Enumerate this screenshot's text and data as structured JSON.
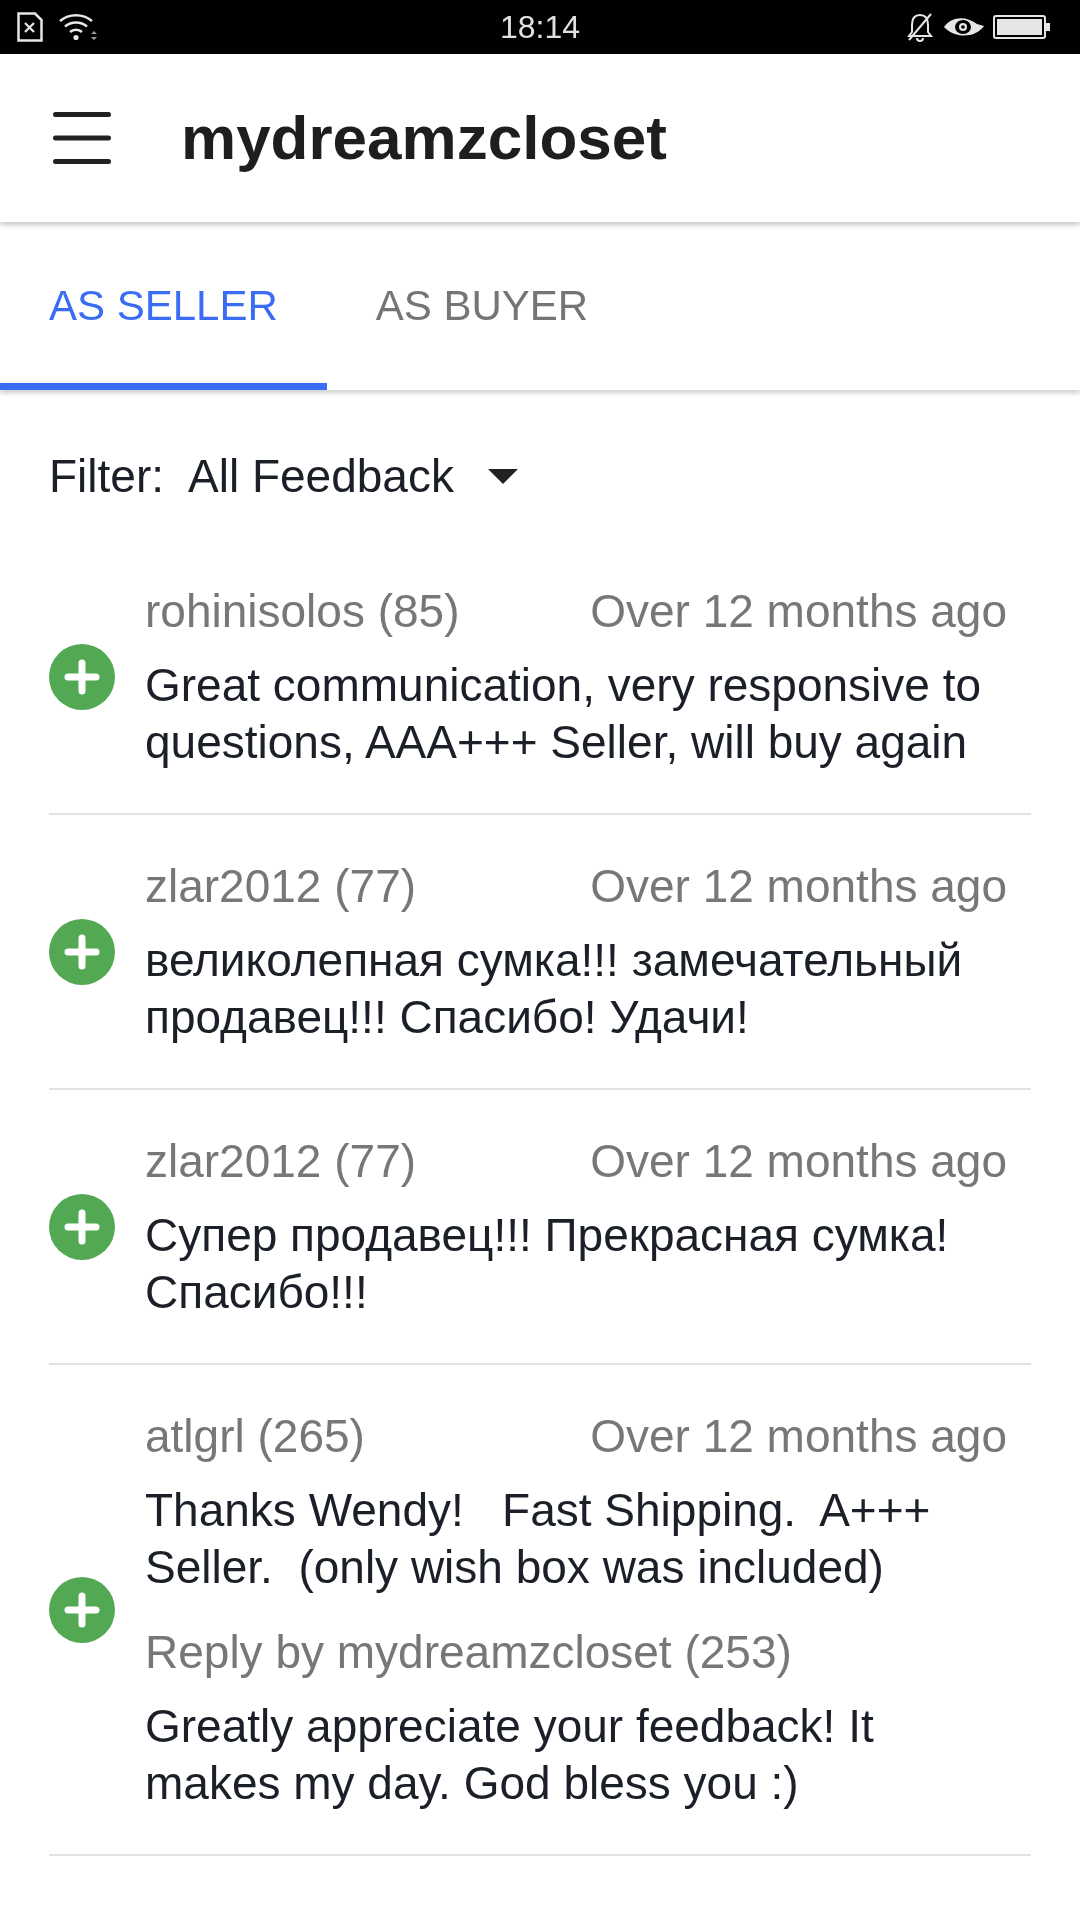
{
  "status_bar": {
    "time": "18:14"
  },
  "app_bar": {
    "title": "mydreamzcloset"
  },
  "tabs": [
    {
      "label": "AS SELLER",
      "selected": true
    },
    {
      "label": "AS BUYER",
      "selected": false
    }
  ],
  "filter": {
    "label": "Filter:",
    "value": "All Feedback"
  },
  "feedback": [
    {
      "user": "rohinisolos (85)",
      "time": "Over 12 months ago",
      "kind": "positive",
      "comment": "Great communication, very responsive to questions, AAA+++ Seller, will buy again"
    },
    {
      "user": "zlar2012 (77)",
      "time": "Over 12 months ago",
      "kind": "positive",
      "comment": "великолепная сумка!!! замечательный продавец!!! Спасибо! Удачи!"
    },
    {
      "user": "zlar2012 (77)",
      "time": "Over 12 months ago",
      "kind": "positive",
      "comment": "Супер продавец!!! Прекрасная сумка! Спасибо!!!"
    },
    {
      "user": "atlgrl (265)",
      "time": "Over 12 months ago",
      "kind": "positive",
      "comment": "Thanks Wendy!   Fast Shipping.  A+++ Seller.  (only wish box was included)",
      "reply": {
        "label": "Reply by mydreamzcloset (253)",
        "text": "Greatly appreciate your feedback! It makes my day. God bless you :)"
      }
    }
  ]
}
